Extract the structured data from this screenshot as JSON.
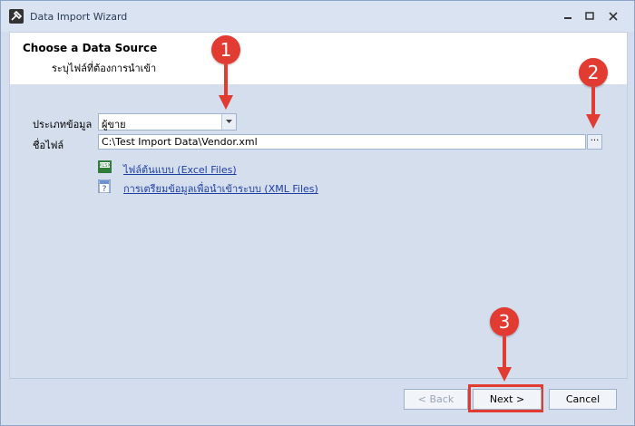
{
  "window": {
    "title": "Data Import Wizard"
  },
  "header": {
    "title": "Choose a Data Source",
    "subtitle": "ระบุไฟล์ที่ต้องการนำเข้า"
  },
  "form": {
    "data_type_label": "ประเภทข้อมูล",
    "data_type_value": "ผู้ขาย",
    "file_label": "ชื่อไฟล์",
    "file_value": "C:\\Test Import Data\\Vendor.xml",
    "browse_label": "···"
  },
  "links": [
    {
      "label": "ไฟล์ต้นแบบ (Excel Files)",
      "icon": "excel-file-icon"
    },
    {
      "label": "การเตรียมข้อมูลเพื่อนำเข้าระบบ (XML Files)",
      "icon": "help-document-icon"
    }
  ],
  "buttons": {
    "back": "< Back",
    "next": "Next >",
    "cancel": "Cancel"
  },
  "callouts": [
    "1",
    "2",
    "3"
  ],
  "colors": {
    "callout": "#e23b32",
    "link": "#1f3ea3",
    "background": "#d3dded"
  }
}
